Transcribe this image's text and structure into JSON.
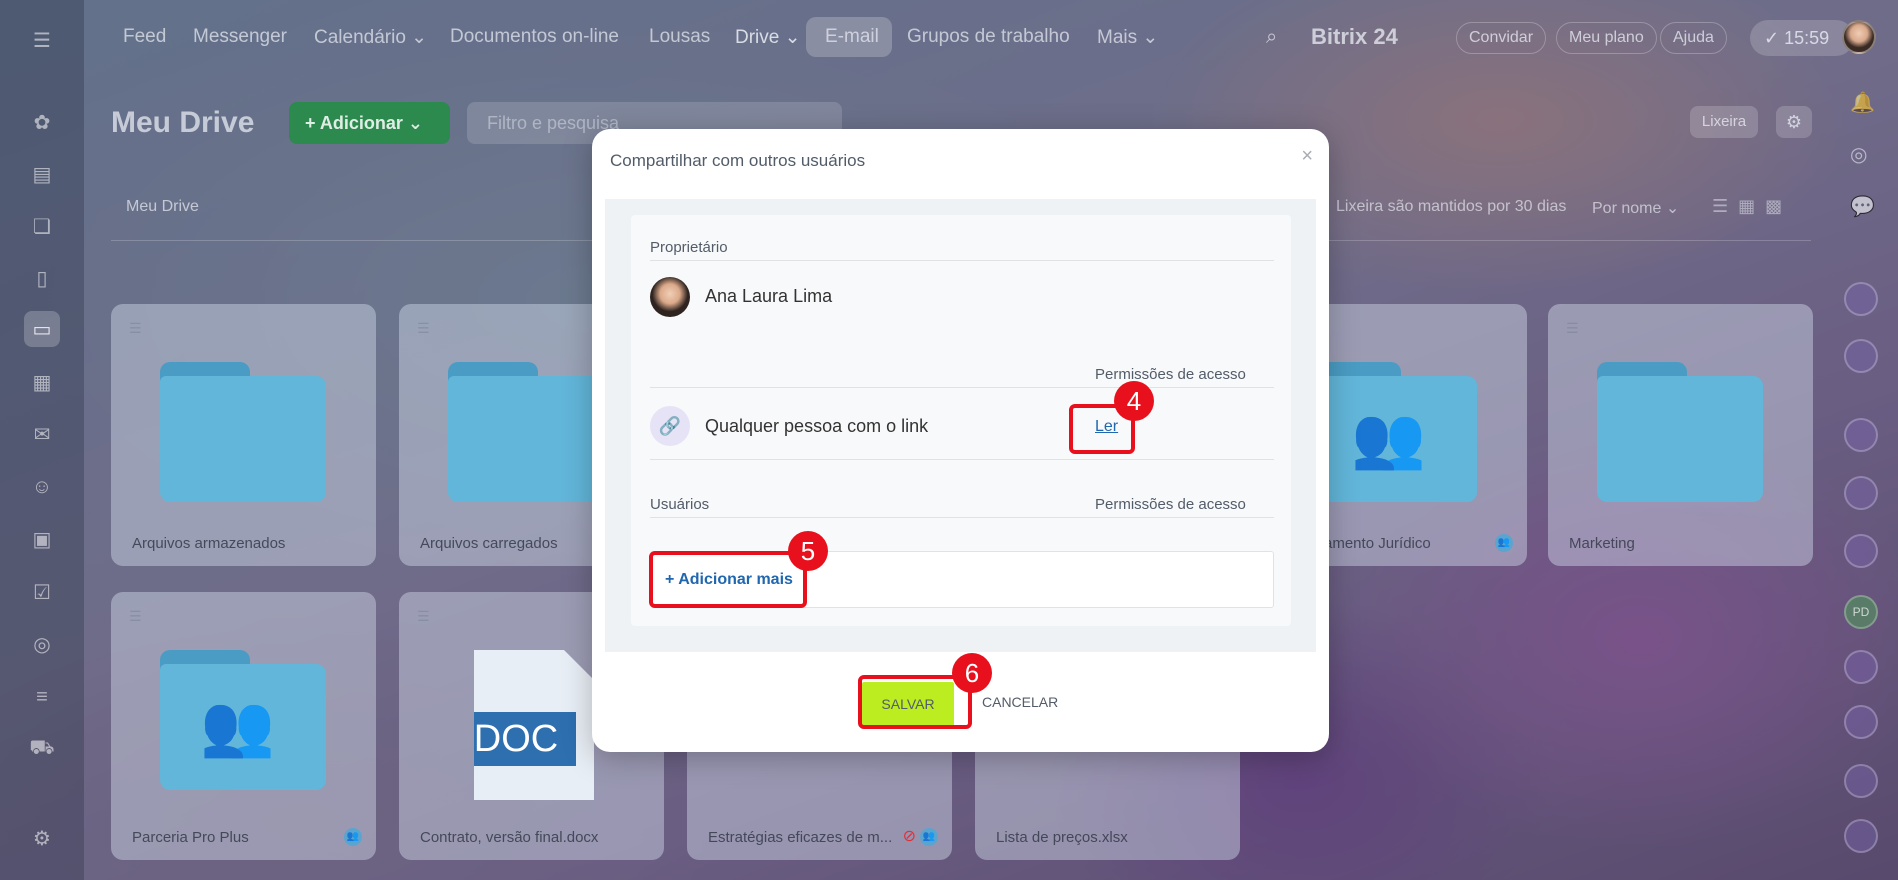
{
  "nav": {
    "items": [
      "Feed",
      "Messenger",
      "Calendário ⌄",
      "Documentos on-line",
      "Lousas",
      "Drive ⌄",
      "E-mail",
      "Grupos de trabalho",
      "Mais ⌄"
    ],
    "brand": "Bitrix 24",
    "invite": "Convidar",
    "plan": "Meu plano",
    "help": "Ajuda",
    "time": "15:59"
  },
  "page": {
    "title": "Meu Drive",
    "add_button": "Adicionar",
    "filter_placeholder": "Filtro e pesquisa",
    "trash_button": "Lixeira",
    "breadcrumb": "Meu Drive",
    "trash_note": "Lixeira são mantidos por 30 dias",
    "sort": "Por nome"
  },
  "tiles": [
    {
      "name": "Arquivos armazenados"
    },
    {
      "name": "Arquivos carregados"
    },
    {
      "name": "amento Jurídico"
    },
    {
      "name": "Marketing"
    },
    {
      "name": "Parceria Pro Plus"
    },
    {
      "name": "Contrato, versão final.docx"
    },
    {
      "name": "Estratégias eficazes de m..."
    },
    {
      "name": "Lista de preços.xlsx"
    }
  ],
  "doc_label": "DOC",
  "right_rail_badge": "PD",
  "modal": {
    "title": "Compartilhar com outros usuários",
    "owner_label": "Proprietário",
    "owner_name": "Ana Laura Lima",
    "access_header": "Permissões de acesso",
    "link_label": "Qualquer pessoa com o link",
    "link_permission": "Ler",
    "users_label": "Usuários",
    "users_access_header": "Permissões de acesso",
    "add_more": "Adicionar mais",
    "save": "SALVAR",
    "cancel": "CANCELAR"
  },
  "annotations": [
    "4",
    "5",
    "6"
  ],
  "colors": {
    "highlight": "#e8101c",
    "save_button": "#bbed21",
    "link_blue": "#2067b0",
    "add_button": "#2c8a4e",
    "folder": "#62b6da"
  }
}
